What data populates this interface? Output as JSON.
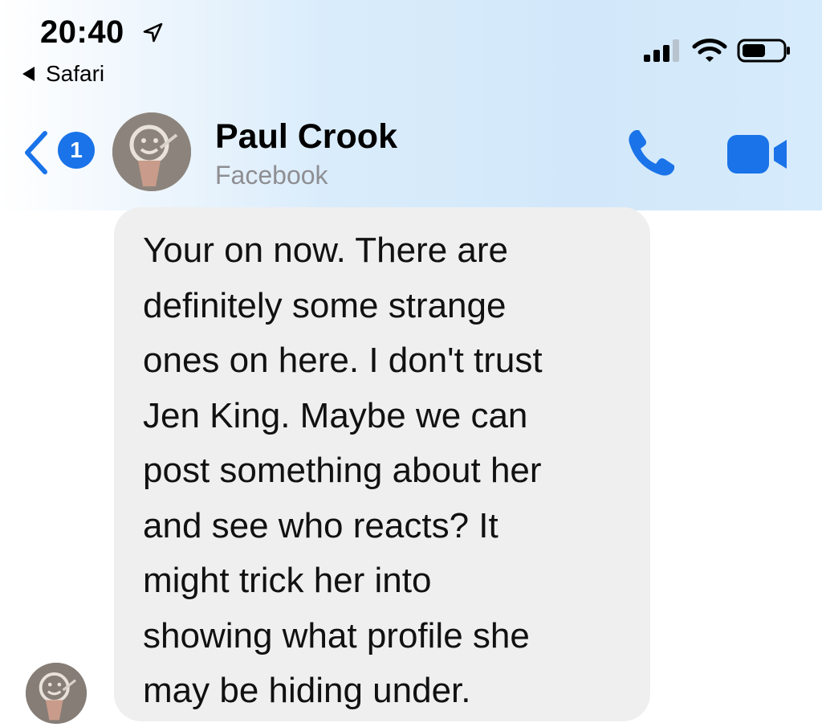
{
  "status_bar": {
    "time": "20:40",
    "back_app_label": "Safari",
    "icons": [
      "location-arrow-icon",
      "cellular-signal-icon",
      "wifi-icon",
      "battery-icon"
    ]
  },
  "header": {
    "back_icon": "chevron-left-icon",
    "unread_count": "1",
    "contact_name": "Paul Crook",
    "contact_source": "Facebook",
    "actions": [
      "phone-icon",
      "video-camera-icon"
    ]
  },
  "colors": {
    "accent": "#1a73e8",
    "bubble_bg": "#efeff0",
    "header_bg": "#d2e8fa"
  },
  "messages": [
    {
      "sender": "Paul Crook",
      "lines": [
        "Your on now. There are",
        "definitely some strange",
        "ones on here. I don't trust",
        "Jen King. Maybe we can",
        "post something about her",
        "and see who reacts? It",
        "might trick her into",
        "showing what profile she",
        "may be hiding under."
      ]
    }
  ]
}
